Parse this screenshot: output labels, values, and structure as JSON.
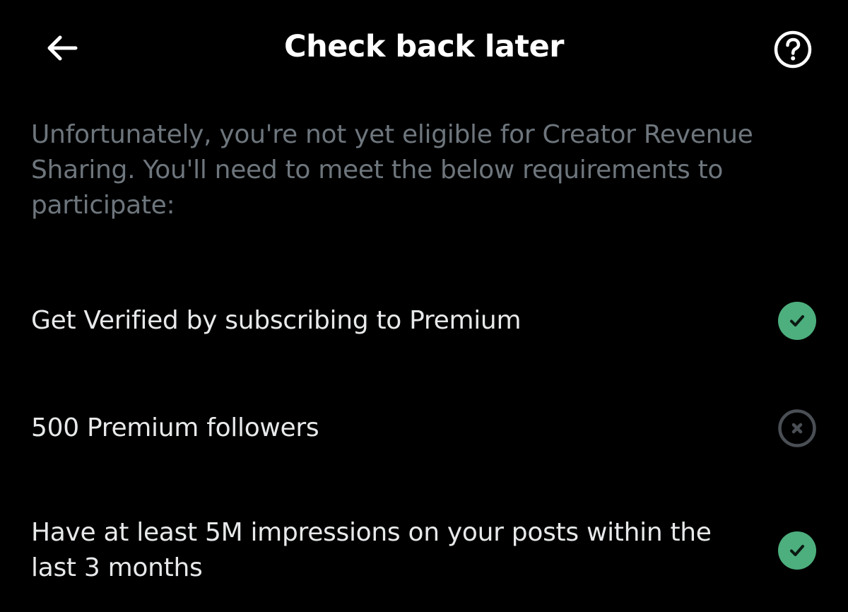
{
  "header": {
    "title": "Check back later",
    "back_icon": "arrow-left-icon",
    "help_icon": "question-circle-icon"
  },
  "intro": {
    "text": "Unfortunately, you're not yet eligible for Creator Revenue Sharing. You'll need to meet the below requirements to participate:"
  },
  "requirements": [
    {
      "label": "Get Verified by subscribing to Premium",
      "status": "met",
      "icon": "check-circle-icon"
    },
    {
      "label": "500 Premium followers",
      "status": "not-met",
      "icon": "x-circle-icon"
    },
    {
      "label": "Have at least 5M impressions on your posts within the last 3 months",
      "status": "met",
      "icon": "check-circle-icon"
    }
  ],
  "colors": {
    "background": "#000000",
    "title": "#ffffff",
    "intro_text": "#6e767d",
    "requirement_text": "#e7e9ea",
    "met": "#4caf7d",
    "not_met": "#4a4f55"
  }
}
